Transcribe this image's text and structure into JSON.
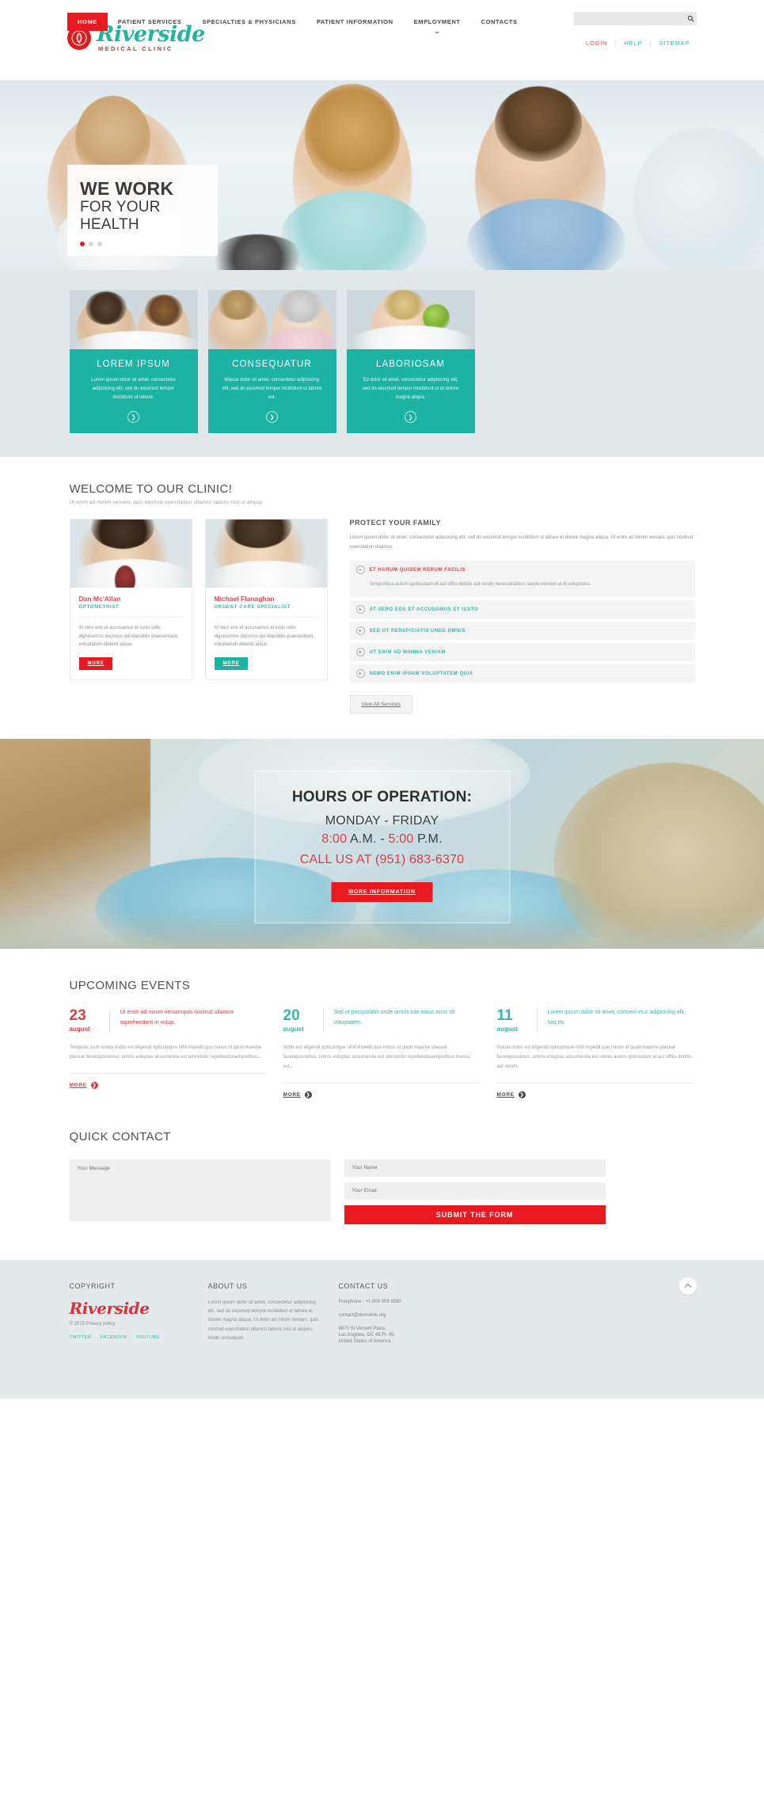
{
  "colors": {
    "red": "#e8191f",
    "teal": "#1cb3a4",
    "tealLight": "#2fb9ab",
    "grayBand": "#e2e8ea",
    "footer": "#e4e9eb"
  },
  "header": {
    "logo": {
      "name": "Riverside",
      "sub": "MEDICAL CLINIC",
      "icon": "leaf-logo-icon"
    },
    "toplinks": [
      {
        "label": "LOGIN",
        "name": "login-link"
      },
      {
        "label": "HELP",
        "name": "help-link"
      },
      {
        "label": "SITEMAP",
        "name": "sitemap-link"
      }
    ],
    "nav": [
      {
        "label": "HOME",
        "active": true,
        "caret": false
      },
      {
        "label": "PATIENT SERVICES",
        "active": false,
        "caret": false
      },
      {
        "label": "SPECIALTIES & PHYSICIANS",
        "active": false,
        "caret": false
      },
      {
        "label": "PATIENT INFORMATION",
        "active": false,
        "caret": false
      },
      {
        "label": "EMPLOYMENT",
        "active": false,
        "caret": true
      },
      {
        "label": "CONTACTS",
        "active": false,
        "caret": false
      }
    ],
    "search": {
      "value": "",
      "placeholder": "",
      "icon": "search-icon"
    }
  },
  "hero": {
    "line1": "WE WORK",
    "line2": "FOR YOUR HEALTH",
    "dots": [
      true,
      false,
      false
    ]
  },
  "service_cards": [
    {
      "title": "LOREM IPSUM",
      "text": "Lorem ipsum dolor sit amet, consectetur adipisicing elit, sed do eiusmod tempor incididunt ut labore.",
      "arrow": "chevron-right-icon"
    },
    {
      "title": "CONSEQUATUR",
      "text": "Massa dolor sit amet, consectetur adipisicing elit, sed do eiusmod tempor incididunt ut labore est.",
      "arrow": "chevron-right-icon"
    },
    {
      "title": "LABORIOSAM",
      "text": "Ed dolor sit amet, consectetur adipisicing elit, sed do eiusmod tempor incididunt ut et dolore magna aliqua.",
      "arrow": "chevron-right-icon"
    }
  ],
  "welcome": {
    "title": "WELCOME TO OUR CLINIC!",
    "subtitle": "Ut enim ad minim veniam, quis nostrud exercitation ullamco laboris nisi ut aliquip",
    "doctors": [
      {
        "name": "Dan Mc'Allan",
        "role": "OPTOMETRIST",
        "text": "At vero eos et accusamus et iusto odio dignissimos ducimus qui blanditiis praesentium, voluptatum deleniti atque.",
        "button": "MORE"
      },
      {
        "name": "Michael Flanaghan",
        "role": "URGENT CARE SPECIALIST",
        "text": "At vero eos et accusamus et iusto odio dignissimos ducimus qui blanditiis praesentium, voluptatum deleniti atque.",
        "button": "MORE"
      }
    ],
    "family": {
      "title": "PROTECT YOUR FAMILY",
      "text": "Lorem ipsum dolor sit amet, consectetur adipisicing elit, sed do eiusmod tempor incididunt ut labore et dolore magna aliqua. Ut enim ad minim veniam, quis nostrud exercitation ullamco.",
      "accordion": [
        {
          "label": "ET HARUM QUIDEM RERUM FACILIS",
          "open": true,
          "icon": "minus-circle-icon",
          "body": "Temporibus autem quibusdam et aut offiis debitis aut rerum necessitatibus saepe.eveniet ut et voluptates."
        },
        {
          "label": "AT VERO EOS ET ACCUSAMUS ET IUSTO",
          "open": false,
          "icon": "plus-circle-icon",
          "body": ""
        },
        {
          "label": "SED UT PERSPICIATIS UNDE OMNIS",
          "open": false,
          "icon": "plus-circle-icon",
          "body": ""
        },
        {
          "label": "UT ENIM AD MINIMA VENIAM",
          "open": false,
          "icon": "plus-circle-icon",
          "body": ""
        },
        {
          "label": "NEMO ENIM IPSAM VOLUPTATEM QUIA",
          "open": false,
          "icon": "plus-circle-icon",
          "body": ""
        }
      ],
      "view_all": "View All Services"
    }
  },
  "hours": {
    "title": "HOURS OF OPERATION:",
    "days": "MONDAY - FRIDAY",
    "time_open": "8:00",
    "time_open_suffix": " A.M. - ",
    "time_close": "5:00",
    "time_close_suffix": " P.M.",
    "call": "CALL US AT (951) 683-6370",
    "button": "MORE INFORMATION"
  },
  "events": {
    "title": "UPCOMING EVENTS",
    "items": [
      {
        "day": "23",
        "month": "august",
        "color": "red",
        "headline": "Ut enim ad minim veniamquis nostrud ullamco reprehenderit in volup.",
        "text": "Tempore, cum soluta nobis est eligendi opticumque nihil impedit quo minus id quod maxime placeat facerepossimus, omnis voluptas assumenda est omnidolor repellendusemporibus...",
        "more": "MORE"
      },
      {
        "day": "20",
        "month": "august",
        "color": "teal",
        "headline": "Sed ut perspiciatis unde omnis iste natus error sit voluptatem.",
        "text": "Vobis est eligendi opticumque nihil impedit quo minus id quod maxime placeat facerepossimus, omnis voluptas assumenda est omnidolor repellendusemporibus massa est...",
        "more": "MORE"
      },
      {
        "day": "11",
        "month": "august",
        "color": "teal",
        "headline": "Lorem ipsum dolor sit amet, consect-etur adipisicing elit, sed do.",
        "text": "Soluta nobis est eligendi opticumque nihil impedit quo minus id quod maxime placeat facerepossimus, omnis voluptas arisumenda est omnis autem quibusdam et aut offiiis debitis aut rerum.",
        "more": "MORE"
      }
    ]
  },
  "quick_contact": {
    "title": "QUICK CONTACT",
    "message_placeholder": "Your Message",
    "name_placeholder": "Your Name",
    "email_placeholder": "Your Email",
    "submit": "SUBMIT THE FORM"
  },
  "footer": {
    "copyright": {
      "title": "COPYRIGHT",
      "logo": "Riverside",
      "line": "© 2015 Privacy policy",
      "social": [
        "TWITTER",
        "FACEBOOK",
        "YOUTUBE"
      ]
    },
    "about": {
      "title": "ABOUT US",
      "text": "Lorem ipsum dolor sit amet, consectetur adipisicing elit, sed do eiusmod tempor incididunt ut labore et dolore magna aliqua. Ut enim ad minim veniam, quis nostrud exercitation ullamco laboris nisi ut aliques modo consequat."
    },
    "contact": {
      "title": "CONTACT US",
      "freephone_label": "Freephone :",
      "freephone": "+1 800 559 6580",
      "email": "contact@demolink.org",
      "address1": "9870 St Vincent Place,",
      "address2": "Los Angeles, DC 45 Fr. 45.",
      "address3": "United States of America"
    },
    "to_top_icon": "chevron-up-icon"
  }
}
